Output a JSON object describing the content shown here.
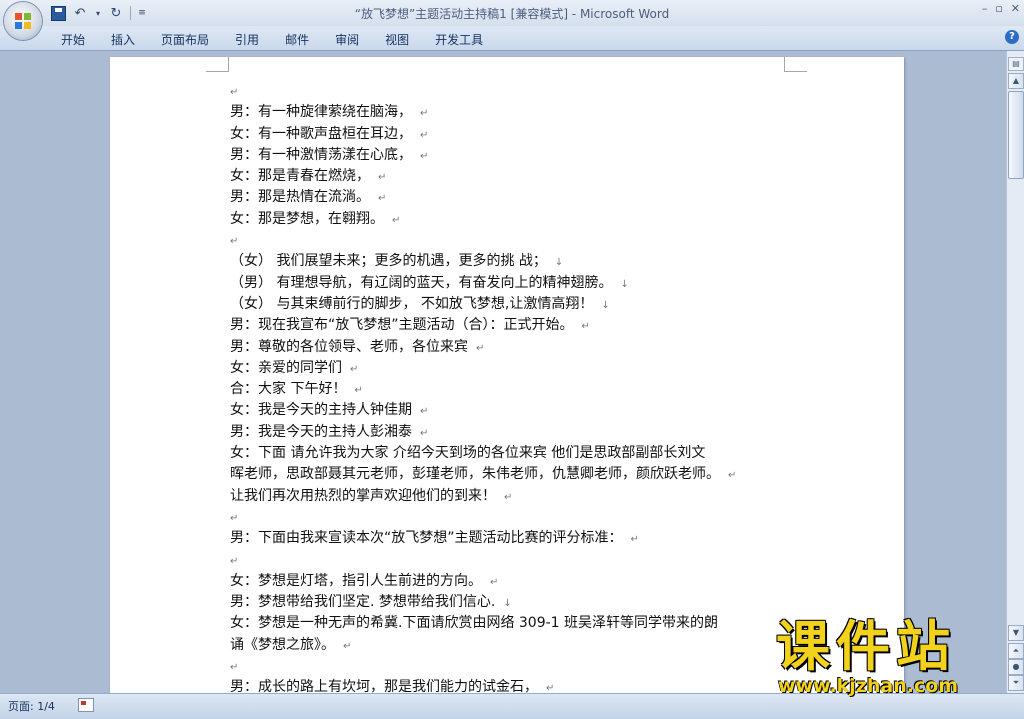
{
  "window": {
    "title": "“放飞梦想”主题活动主持稿1 [兼容模式] - Microsoft Word"
  },
  "quick_access": {
    "icons": [
      "save-icon",
      "undo-icon",
      "redo-icon",
      "customize-icon"
    ]
  },
  "ribbon": {
    "tabs": [
      "开始",
      "插入",
      "页面布局",
      "引用",
      "邮件",
      "审阅",
      "视图",
      "开发工具"
    ]
  },
  "document": {
    "lines": [
      {
        "text": "",
        "mark": "↵"
      },
      {
        "text": "男：有一种旋律萦绕在脑海，",
        "mark": "↵"
      },
      {
        "text": "女：有一种歌声盘桓在耳边，",
        "mark": "↵"
      },
      {
        "text": "男：有一种激情荡漾在心底，",
        "mark": "↵"
      },
      {
        "text": "女：那是青春在燃烧，",
        "mark": "↵"
      },
      {
        "text": "男：那是热情在流淌。",
        "mark": "↵"
      },
      {
        "text": "女：那是梦想，在翱翔。",
        "mark": "↵"
      },
      {
        "text": "",
        "mark": "↵"
      },
      {
        "text": "（女） 我们展望未来；更多的机遇，更多的挑 战；",
        "mark": "↓"
      },
      {
        "text": "（男） 有理想导航，有辽阔的蓝天，有奋发向上的精神翅膀。",
        "mark": "↓"
      },
      {
        "text": "（女） 与其束缚前行的脚步， 不如放飞梦想,让激情高翔！",
        "mark": "↓"
      },
      {
        "text": "男：现在我宣布“放飞梦想”主题活动（合）：正式开始。",
        "mark": "↵"
      },
      {
        "text": "男：尊敬的各位领导、老师，各位来宾",
        "mark": "↵"
      },
      {
        "text": "女：亲爱的同学们",
        "mark": "↵"
      },
      {
        "text": "合：大家  下午好！",
        "mark": "↵"
      },
      {
        "text": "女：我是今天的主持人钟佳期",
        "mark": "↵"
      },
      {
        "text": "男：我是今天的主持人彭湘泰",
        "mark": "↵"
      },
      {
        "text": "女：下面 请允许我为大家 介绍今天到场的各位来宾  他们是思政部副部长刘文",
        "mark": ""
      },
      {
        "text": "晖老师，思政部聂其元老师，彭瑾老师，朱伟老师，仇慧卿老师，颜欣跃老师。",
        "mark": "↵"
      },
      {
        "text": "让我们再次用热烈的掌声欢迎他们的到来！",
        "mark": "↵"
      },
      {
        "text": "",
        "mark": "↵"
      },
      {
        "text": "男：下面由我来宣读本次“放飞梦想”主题活动比赛的评分标准：",
        "mark": "↵"
      },
      {
        "text": "",
        "mark": "↵"
      },
      {
        "text": "女：梦想是灯塔，指引人生前进的方向。",
        "mark": "↵"
      },
      {
        "text": "男：梦想带给我们坚定. 梦想带给我们信心.",
        "mark": "↓"
      },
      {
        "text": "女：梦想是一种无声的希冀.下面请欣赏由网络 309-1 班吴泽轩等同学带来的朗",
        "mark": ""
      },
      {
        "text": "诵《梦想之旅》。",
        "mark": "↵"
      },
      {
        "text": "",
        "mark": "↵"
      },
      {
        "text": "男：成长的路上有坎坷，那是我们能力的试金石，",
        "mark": "↵"
      }
    ]
  },
  "status_bar": {
    "page_label": "页面: 1/4"
  },
  "watermark": {
    "title": "课件站",
    "url": "www.kjzhan.com"
  }
}
